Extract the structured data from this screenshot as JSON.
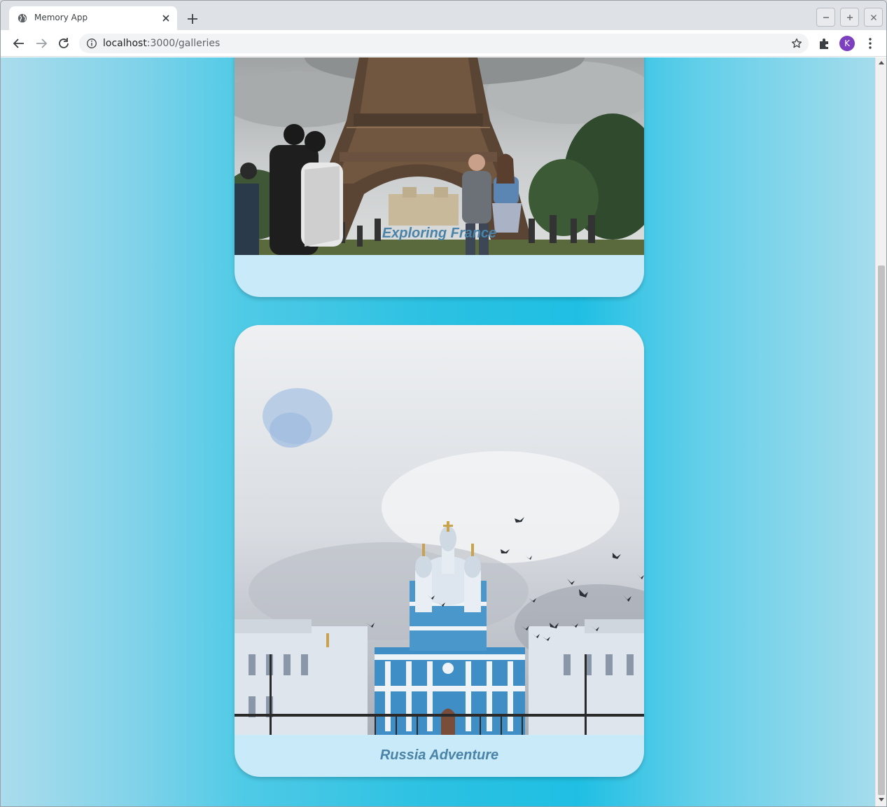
{
  "browser": {
    "tab_title": "Memory App",
    "url_host": "localhost",
    "url_path": ":3000/galleries",
    "avatar_letter": "K"
  },
  "galleries": [
    {
      "caption": "Exploring France",
      "photo": "eiffel-tower-photo"
    },
    {
      "caption": "Russia Adventure",
      "photo": "smolny-cathedral-photo"
    }
  ]
}
